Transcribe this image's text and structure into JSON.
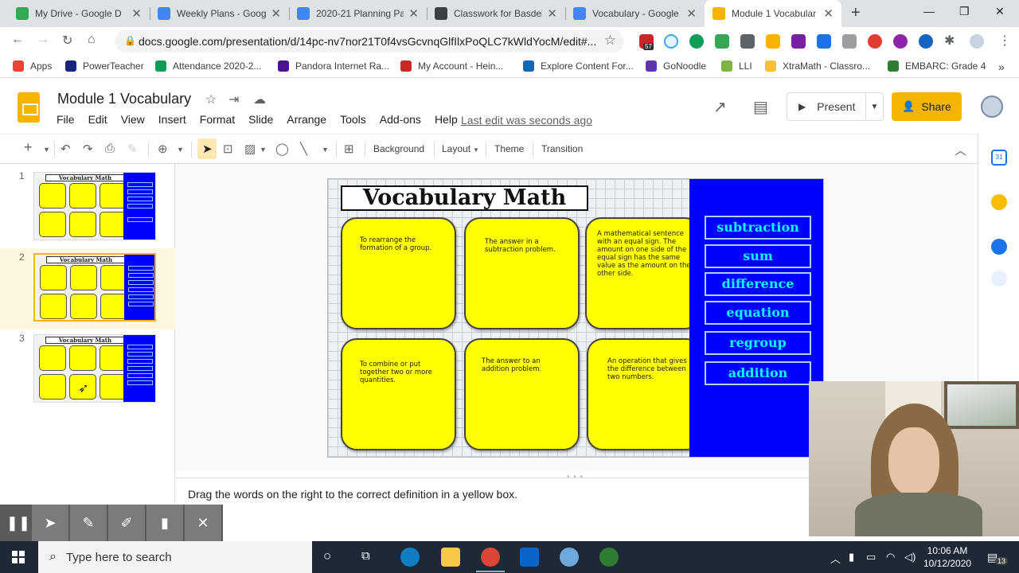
{
  "browser": {
    "tabs": [
      {
        "title": "My Drive - Google D",
        "color": "#34a853"
      },
      {
        "title": "Weekly Plans - Goog",
        "color": "#4285f4"
      },
      {
        "title": "2020-21 Planning Pa",
        "color": "#4285f4"
      },
      {
        "title": "Classwork for Basdel",
        "color": "#3c4043"
      },
      {
        "title": "Vocabulary - Google",
        "color": "#4285f4"
      },
      {
        "title": "Module 1 Vocabular",
        "color": "#f4b400"
      }
    ],
    "active_tab": 5,
    "url": "docs.google.com/presentation/d/14pc-nv7nor21T0f4vsGcvnqGlfIlxPoQLC7kWldYocM/edit#...",
    "ext_badge": "57",
    "bookmarks": [
      {
        "label": "Apps",
        "color": "#ea4335"
      },
      {
        "label": "PowerTeacher",
        "color": "#1a237e"
      },
      {
        "label": "Attendance 2020-2...",
        "color": "#0f9d58"
      },
      {
        "label": "Pandora Internet Ra...",
        "color": "#4a148c"
      },
      {
        "label": "My Account - Hein...",
        "color": "#c62828"
      },
      {
        "label": "Explore Content For...",
        "color": "#1565c0"
      },
      {
        "label": "GoNoodle",
        "color": "#5e35b1"
      },
      {
        "label": "LLI",
        "color": "#7cb342"
      },
      {
        "label": "XtraMath - Classro...",
        "color": "#fbc02d"
      },
      {
        "label": "EMBARC: Grade 4",
        "color": "#2e7d32"
      }
    ]
  },
  "app": {
    "title": "Module 1 Vocabulary",
    "menu": [
      "File",
      "Edit",
      "View",
      "Insert",
      "Format",
      "Slide",
      "Arrange",
      "Tools",
      "Add-ons",
      "Help"
    ],
    "last_edit": "Last edit was seconds ago",
    "present_label": "Present",
    "share_label": "Share",
    "accent": "#f4b400"
  },
  "toolbar": {
    "background": "Background",
    "layout": "Layout",
    "theme": "Theme",
    "transition": "Transition"
  },
  "filmstrip": {
    "selected": 2,
    "slides": [
      {
        "num": "1",
        "title": "Vocabulary Math"
      },
      {
        "num": "2",
        "title": "Vocabulary Math"
      },
      {
        "num": "3",
        "title": "Vocabulary Math"
      }
    ]
  },
  "slide": {
    "title": "Vocabulary Math",
    "definitions": [
      "To rearrange the formation of a group.",
      "The answer in a subtraction problem.",
      "A mathematical sentence with an equal sign.  The amount on one side of the equal sign has the same value as the amount on the other side.",
      "To combine or put together two or more quantities.",
      "The answer to an addition problem.",
      "An operation that gives the difference between two numbers."
    ],
    "words": [
      "subtraction",
      "sum",
      "difference",
      "equation",
      "regroup",
      "addition"
    ],
    "box_color": "#ffff00",
    "panel_color": "#0000ff",
    "word_color": "#00ffff"
  },
  "notes": "Drag the words on the right to the correct definition in a yellow box.",
  "taskbar": {
    "search_placeholder": "Type here to search",
    "time": "10:06 AM",
    "date": "10/12/2020",
    "notification_count": "13"
  }
}
